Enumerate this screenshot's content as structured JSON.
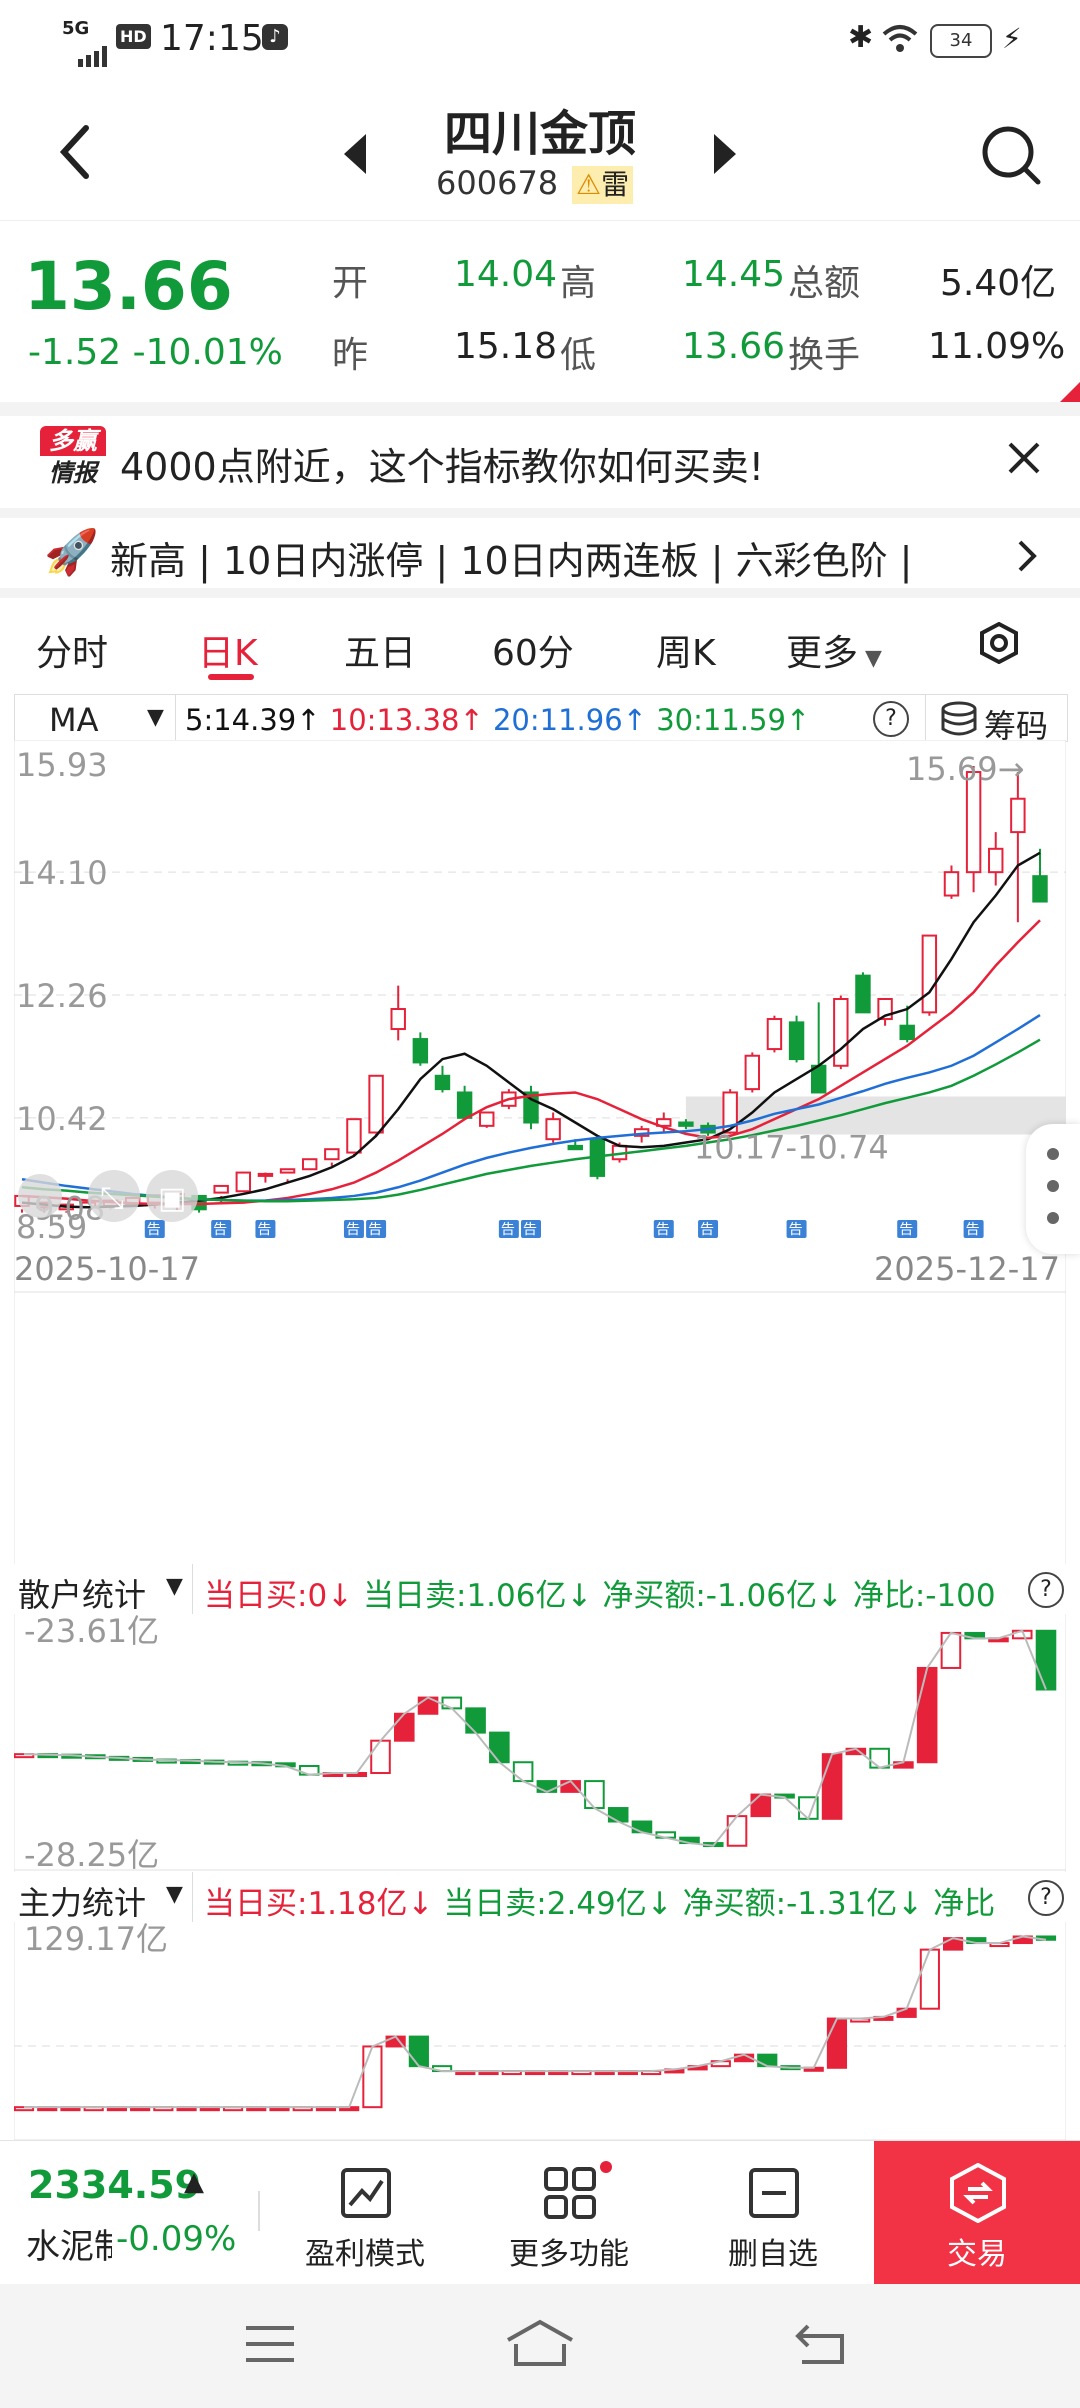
{
  "status": {
    "network": "5G",
    "hd": "HD",
    "time": "17:15",
    "battery": "34"
  },
  "header": {
    "name": "四川金顶",
    "code": "600678",
    "tag": "雷"
  },
  "quote": {
    "price": "13.66",
    "change": "-1.52",
    "change_pct": "-10.01%",
    "open_label": "开",
    "open": "14.04",
    "high_label": "高",
    "high": "14.45",
    "amount_label": "总额",
    "amount": "5.40亿",
    "prev_label": "昨",
    "prev": "15.18",
    "low_label": "低",
    "low": "13.66",
    "turnover_label": "换手",
    "turnover": "11.09%"
  },
  "banner": {
    "logo_top": "多赢",
    "logo_bottom": "情报",
    "text": "4000点附近，这个指标教你如何买卖!"
  },
  "ticker": {
    "text": "新高 | 10日内涨停 | 10日内两连板 | 六彩色阶 |"
  },
  "tabs": [
    "分时",
    "日K",
    "五日",
    "60分",
    "周K",
    "更多"
  ],
  "active_tab": "日K",
  "ma": {
    "label": "MA",
    "ma5": "5:14.39↑",
    "ma10": "10:13.38↑",
    "ma20": "20:11.96↑",
    "ma30": "30:11.59↑",
    "chip_label": "筹码"
  },
  "chart_data": [
    {
      "type": "candlestick",
      "title": "",
      "x_range": [
        "2025-10-17",
        "2025-12-17"
      ],
      "y_ticks": [
        "15.93",
        "14.10",
        "12.26",
        "10.42",
        "8.59"
      ],
      "ylim": [
        8.59,
        15.93
      ],
      "max_label": "15.69→",
      "min_label": "9.08",
      "zone_label": "10.17-10.74",
      "zone": [
        10.17,
        10.74
      ],
      "colors": {
        "up": "#e5223a",
        "down": "#119a3a",
        "ma5": "#111111",
        "ma10": "#e5223a",
        "ma20": "#1f6fd6",
        "ma30": "#119a3a"
      },
      "candles": [
        [
          9.1,
          9.25,
          9.05,
          9.0
        ],
        [
          9.08,
          9.15,
          9.0,
          9.08
        ],
        [
          9.05,
          9.12,
          9.02,
          9.0
        ],
        [
          9.08,
          9.15,
          9.04,
          9.0
        ],
        [
          9.1,
          9.18,
          9.06,
          9.05
        ],
        [
          9.12,
          9.22,
          9.08,
          9.08
        ],
        [
          9.15,
          9.26,
          9.1,
          9.06
        ],
        [
          9.2,
          9.28,
          9.16,
          9.02
        ],
        [
          9.25,
          9.05,
          9.0,
          9.25
        ],
        [
          9.3,
          9.4,
          9.25,
          9.15
        ],
        [
          9.32,
          9.6,
          9.3,
          9.3
        ],
        [
          9.55,
          9.58,
          9.45,
          9.6
        ],
        [
          9.6,
          9.65,
          9.5,
          9.45
        ],
        [
          9.65,
          9.8,
          9.62,
          9.62
        ],
        [
          9.8,
          9.95,
          9.7,
          9.75
        ],
        [
          9.9,
          10.4,
          9.88,
          9.85
        ],
        [
          10.2,
          11.05,
          10.18,
          10.15
        ],
        [
          11.75,
          12.05,
          11.58,
          12.4
        ],
        [
          11.6,
          11.25,
          11.2,
          11.7
        ],
        [
          11.05,
          10.85,
          10.8,
          11.2
        ],
        [
          10.8,
          10.42,
          10.4,
          10.9
        ],
        [
          10.3,
          10.5,
          10.27,
          10.4
        ],
        [
          10.6,
          10.8,
          10.55,
          10.85
        ],
        [
          10.8,
          10.35,
          10.25,
          10.9
        ],
        [
          10.1,
          10.4,
          10.05,
          10.5
        ],
        [
          10.0,
          9.95,
          9.95,
          10.1
        ],
        [
          10.1,
          9.55,
          9.5,
          10.15
        ],
        [
          9.8,
          10.0,
          9.75,
          10.05
        ],
        [
          10.15,
          10.25,
          10.05,
          10.3
        ],
        [
          10.3,
          10.4,
          10.2,
          10.5
        ],
        [
          10.35,
          10.3,
          10.25,
          10.4
        ],
        [
          10.3,
          10.2,
          10.15,
          10.35
        ],
        [
          10.2,
          10.8,
          10.18,
          10.85
        ],
        [
          10.85,
          11.35,
          10.8,
          11.4
        ],
        [
          11.45,
          11.9,
          11.4,
          11.95
        ],
        [
          11.85,
          11.3,
          11.25,
          11.95
        ],
        [
          11.2,
          10.8,
          10.8,
          12.15
        ],
        [
          11.2,
          12.2,
          11.15,
          12.25
        ],
        [
          12.55,
          12.0,
          12.0,
          12.6
        ],
        [
          11.9,
          12.2,
          11.8,
          12.2
        ],
        [
          11.8,
          11.6,
          11.55,
          12.1
        ],
        [
          12.0,
          13.15,
          11.95,
          13.15
        ],
        [
          13.75,
          14.1,
          13.7,
          14.2
        ],
        [
          14.1,
          15.6,
          13.8,
          15.69
        ],
        [
          14.1,
          14.45,
          13.9,
          14.7
        ],
        [
          14.7,
          15.2,
          13.35,
          15.6
        ],
        [
          14.04,
          13.66,
          13.66,
          14.45
        ]
      ],
      "ma5": [
        9.15,
        9.12,
        9.09,
        9.08,
        9.09,
        9.1,
        9.12,
        9.15,
        9.18,
        9.22,
        9.28,
        9.35,
        9.45,
        9.55,
        9.68,
        9.85,
        10.15,
        10.55,
        11.0,
        11.3,
        11.38,
        11.2,
        10.95,
        10.7,
        10.55,
        10.35,
        10.15,
        10.0,
        9.98,
        10.0,
        10.05,
        10.1,
        10.25,
        10.5,
        10.8,
        11.0,
        11.2,
        11.45,
        11.75,
        11.95,
        12.05,
        12.3,
        12.8,
        13.35,
        13.75,
        14.2,
        14.39
      ],
      "ma10": [
        9.25,
        9.23,
        9.21,
        9.18,
        9.16,
        9.14,
        9.13,
        9.13,
        9.13,
        9.14,
        9.15,
        9.18,
        9.22,
        9.28,
        9.35,
        9.45,
        9.6,
        9.78,
        9.98,
        10.18,
        10.4,
        10.58,
        10.7,
        10.75,
        10.78,
        10.8,
        10.7,
        10.55,
        10.4,
        10.28,
        10.18,
        10.12,
        10.15,
        10.25,
        10.4,
        10.55,
        10.7,
        10.9,
        11.1,
        11.3,
        11.5,
        11.75,
        12.0,
        12.3,
        12.7,
        13.05,
        13.38
      ],
      "ma20": [
        9.5,
        9.45,
        9.4,
        9.36,
        9.32,
        9.28,
        9.25,
        9.22,
        9.2,
        9.19,
        9.18,
        9.18,
        9.19,
        9.2,
        9.22,
        9.25,
        9.3,
        9.38,
        9.48,
        9.6,
        9.72,
        9.82,
        9.9,
        9.97,
        10.03,
        10.08,
        10.12,
        10.15,
        10.18,
        10.2,
        10.22,
        10.25,
        10.3,
        10.38,
        10.48,
        10.55,
        10.62,
        10.72,
        10.82,
        10.93,
        11.02,
        11.1,
        11.2,
        11.35,
        11.55,
        11.75,
        11.96
      ],
      "ma30": [
        9.38,
        9.35,
        9.33,
        9.3,
        9.28,
        9.26,
        9.24,
        9.22,
        9.2,
        9.19,
        9.18,
        9.17,
        9.17,
        9.18,
        9.19,
        9.2,
        9.22,
        9.27,
        9.34,
        9.42,
        9.5,
        9.58,
        9.64,
        9.7,
        9.75,
        9.8,
        9.84,
        9.88,
        9.92,
        9.96,
        10.0,
        10.05,
        10.1,
        10.16,
        10.23,
        10.3,
        10.38,
        10.46,
        10.55,
        10.64,
        10.72,
        10.8,
        10.9,
        11.05,
        11.22,
        11.4,
        11.59
      ],
      "announcement_marker": "告"
    },
    {
      "type": "bar",
      "name": "散户统计",
      "y_ticks": [
        "-23.61亿",
        "-28.25亿"
      ],
      "ylim": [
        -28.25,
        -23.61
      ],
      "today_buy_label": "当日买:0↓",
      "today_sell_label": "当日卖:1.06亿↓",
      "net_label": "净买额:-1.06亿↓",
      "ratio_label": "净比:-100",
      "values": [
        -26.1,
        -26.11,
        -26.12,
        -26.15,
        -26.17,
        -26.2,
        -26.21,
        -26.22,
        -26.24,
        -26.25,
        -26.27,
        -26.32,
        -26.48,
        -26.45,
        -26.45,
        -25.85,
        -25.35,
        -25.05,
        -25.25,
        -25.7,
        -26.25,
        -26.6,
        -26.8,
        -26.6,
        -27.1,
        -27.35,
        -27.55,
        -27.65,
        -27.75,
        -27.8,
        -27.25,
        -26.85,
        -26.9,
        -27.3,
        -26.1,
        -26.0,
        -26.35,
        -26.25,
        -24.5,
        -23.85,
        -23.95,
        -23.95,
        -23.81,
        -24.9
      ]
    },
    {
      "type": "bar",
      "name": "主力统计",
      "y_ticks": [
        "129.17亿"
      ],
      "ylim": [
        0,
        129.17
      ],
      "today_buy_label": "当日买:1.18亿↓",
      "today_sell_label": "当日卖:2.49亿↓",
      "net_label": "净买额:-1.31亿↓",
      "ratio_label": "净比",
      "values": [
        20,
        20,
        20,
        20,
        20,
        20,
        20,
        20,
        20,
        20,
        20,
        20,
        20,
        20,
        20,
        57,
        63,
        45,
        42,
        42,
        42,
        42,
        42,
        42,
        42,
        42,
        42,
        42,
        43,
        45,
        48,
        52,
        45,
        44,
        44,
        74,
        74,
        75,
        80,
        116,
        123,
        120,
        120,
        124,
        122
      ]
    }
  ],
  "bottom": {
    "index_value": "2334.59",
    "index_name": "水泥制",
    "index_change": "-0.09%",
    "profit": "盈利模式",
    "more": "更多功能",
    "remove": "删自选",
    "trade": "交易"
  }
}
